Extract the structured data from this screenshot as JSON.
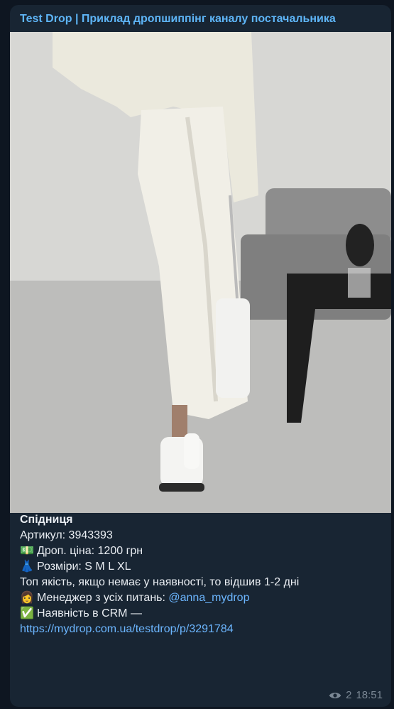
{
  "channel": {
    "name": "Test Drop",
    "separator": "|",
    "subtitle": "Приклад дропшиппінг каналу постачальника"
  },
  "post": {
    "title": "Спідниця",
    "article": "Артикул: 3943393",
    "price_emoji": "💵",
    "price": "Дроп. ціна: 1200 грн",
    "sizes_emoji": "👗",
    "sizes": "Розміри: S M L XL",
    "note": "Топ якість, якщо немає у наявності, то відшив 1-2 дні",
    "manager_emoji": "👩",
    "manager_label": "Менеджер з усіх питань: ",
    "manager_handle": "@anna_mydrop",
    "crm_emoji": "✅",
    "crm_label": "Наявність в CRM —",
    "crm_link": "https://mydrop.com.ua/testdrop/p/3291784"
  },
  "meta": {
    "views": "2",
    "time": "18:51",
    "eye_icon": "eye-icon"
  },
  "colors": {
    "background": "#0e1621",
    "bubble": "#182533",
    "accent": "#5eb5f7",
    "link": "#6cb6ff",
    "meta": "#7b8895"
  }
}
